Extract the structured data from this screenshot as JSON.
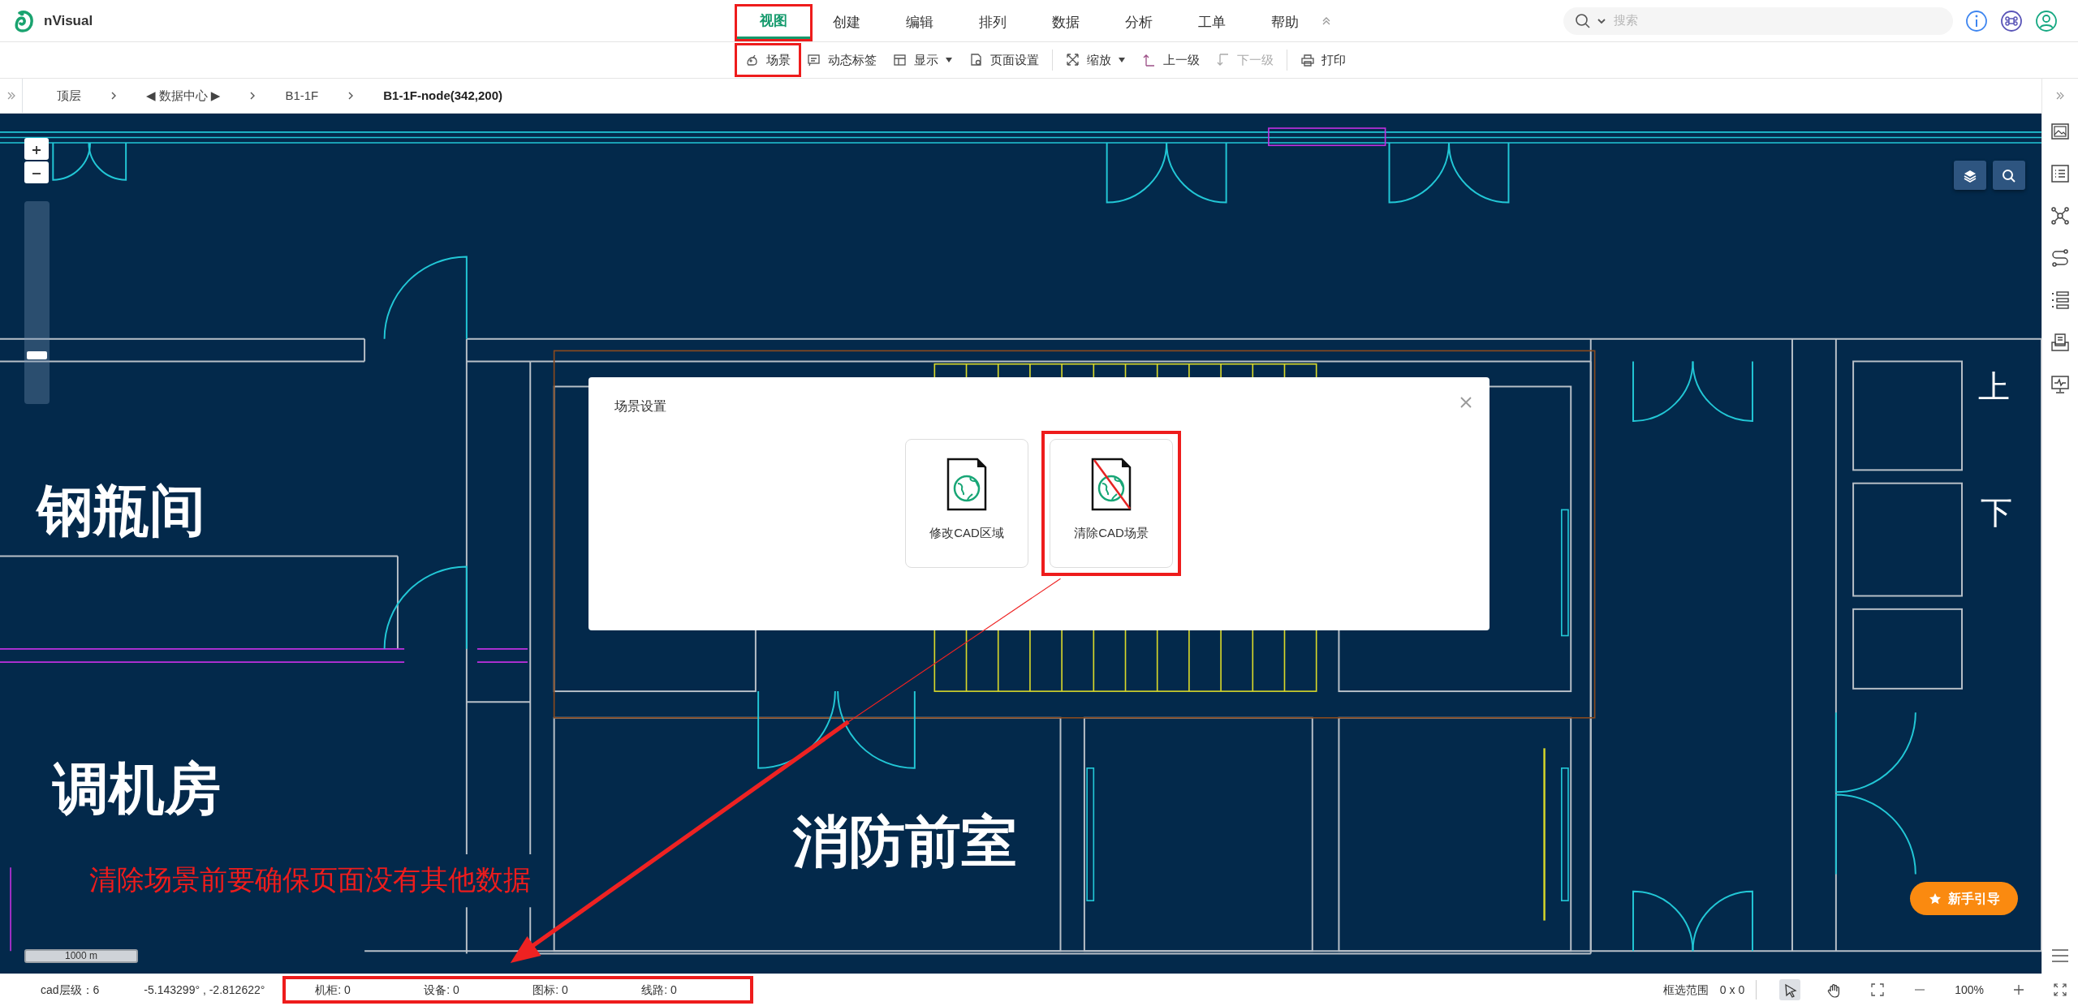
{
  "app": {
    "name": "nVisual"
  },
  "menu": [
    {
      "label": "视图",
      "selected": true,
      "highlighted": true
    },
    {
      "label": "创建",
      "selected": false,
      "highlighted": false
    },
    {
      "label": "编辑",
      "selected": false,
      "highlighted": false
    },
    {
      "label": "排列",
      "selected": false,
      "highlighted": false
    },
    {
      "label": "数据",
      "selected": false,
      "highlighted": false
    },
    {
      "label": "分析",
      "selected": false,
      "highlighted": false
    },
    {
      "label": "工单",
      "selected": false,
      "highlighted": false
    },
    {
      "label": "帮助",
      "selected": false,
      "highlighted": false
    }
  ],
  "search": {
    "placeholder": "搜索"
  },
  "toolbar_groups": [
    {
      "items": [
        {
          "label": "场景",
          "highlighted": true,
          "disabled": false,
          "dropdown": false
        },
        {
          "label": "动态标签",
          "highlighted": false,
          "disabled": false,
          "dropdown": false
        },
        {
          "label": "显示",
          "highlighted": false,
          "disabled": false,
          "dropdown": true
        },
        {
          "label": "页面设置",
          "highlighted": false,
          "disabled": false,
          "dropdown": false
        }
      ]
    },
    {
      "items": [
        {
          "label": "缩放",
          "highlighted": false,
          "disabled": false,
          "dropdown": true
        },
        {
          "label": "上一级",
          "highlighted": false,
          "disabled": false,
          "dropdown": false
        },
        {
          "label": "下一级",
          "highlighted": false,
          "disabled": true,
          "dropdown": false
        }
      ]
    },
    {
      "items": [
        {
          "label": "打印",
          "highlighted": false,
          "disabled": false,
          "dropdown": false
        }
      ]
    }
  ],
  "breadcrumb": [
    {
      "label": "顶层",
      "current": false
    },
    {
      "label": "◀ 数据中心 ▶",
      "current": false
    },
    {
      "label": "B1-1F",
      "current": false
    },
    {
      "label": "B1-1F-node(342,200)",
      "current": true
    }
  ],
  "canvas": {
    "zoom_slider": {
      "level": 0.23
    },
    "room_labels": [
      "钢瓶间",
      "调机房",
      "消防前室"
    ],
    "marks": [
      "上",
      "下"
    ],
    "scale_label": "1000 m",
    "guide_button": "新手引导",
    "annotation_text": "清除场景前要确保页面没有其他数据"
  },
  "dialog": {
    "title": "场景设置",
    "options": [
      {
        "label": "修改CAD区域",
        "crossed": false,
        "highlighted": false
      },
      {
        "label": "清除CAD场景",
        "crossed": true,
        "highlighted": true
      }
    ]
  },
  "status_bar": {
    "cad_level": "cad层级：6",
    "coordinates": "-5.143299° , -2.812622°",
    "counts": [
      "机柜: 0",
      "设备: 0",
      "图标: 0",
      "线路: 0"
    ],
    "counts_highlighted": true,
    "selection_label": "框选范围",
    "selection_value": "0 x 0",
    "tools": [
      {
        "selected": true
      },
      {
        "selected": false
      }
    ],
    "zoom": "100%"
  }
}
